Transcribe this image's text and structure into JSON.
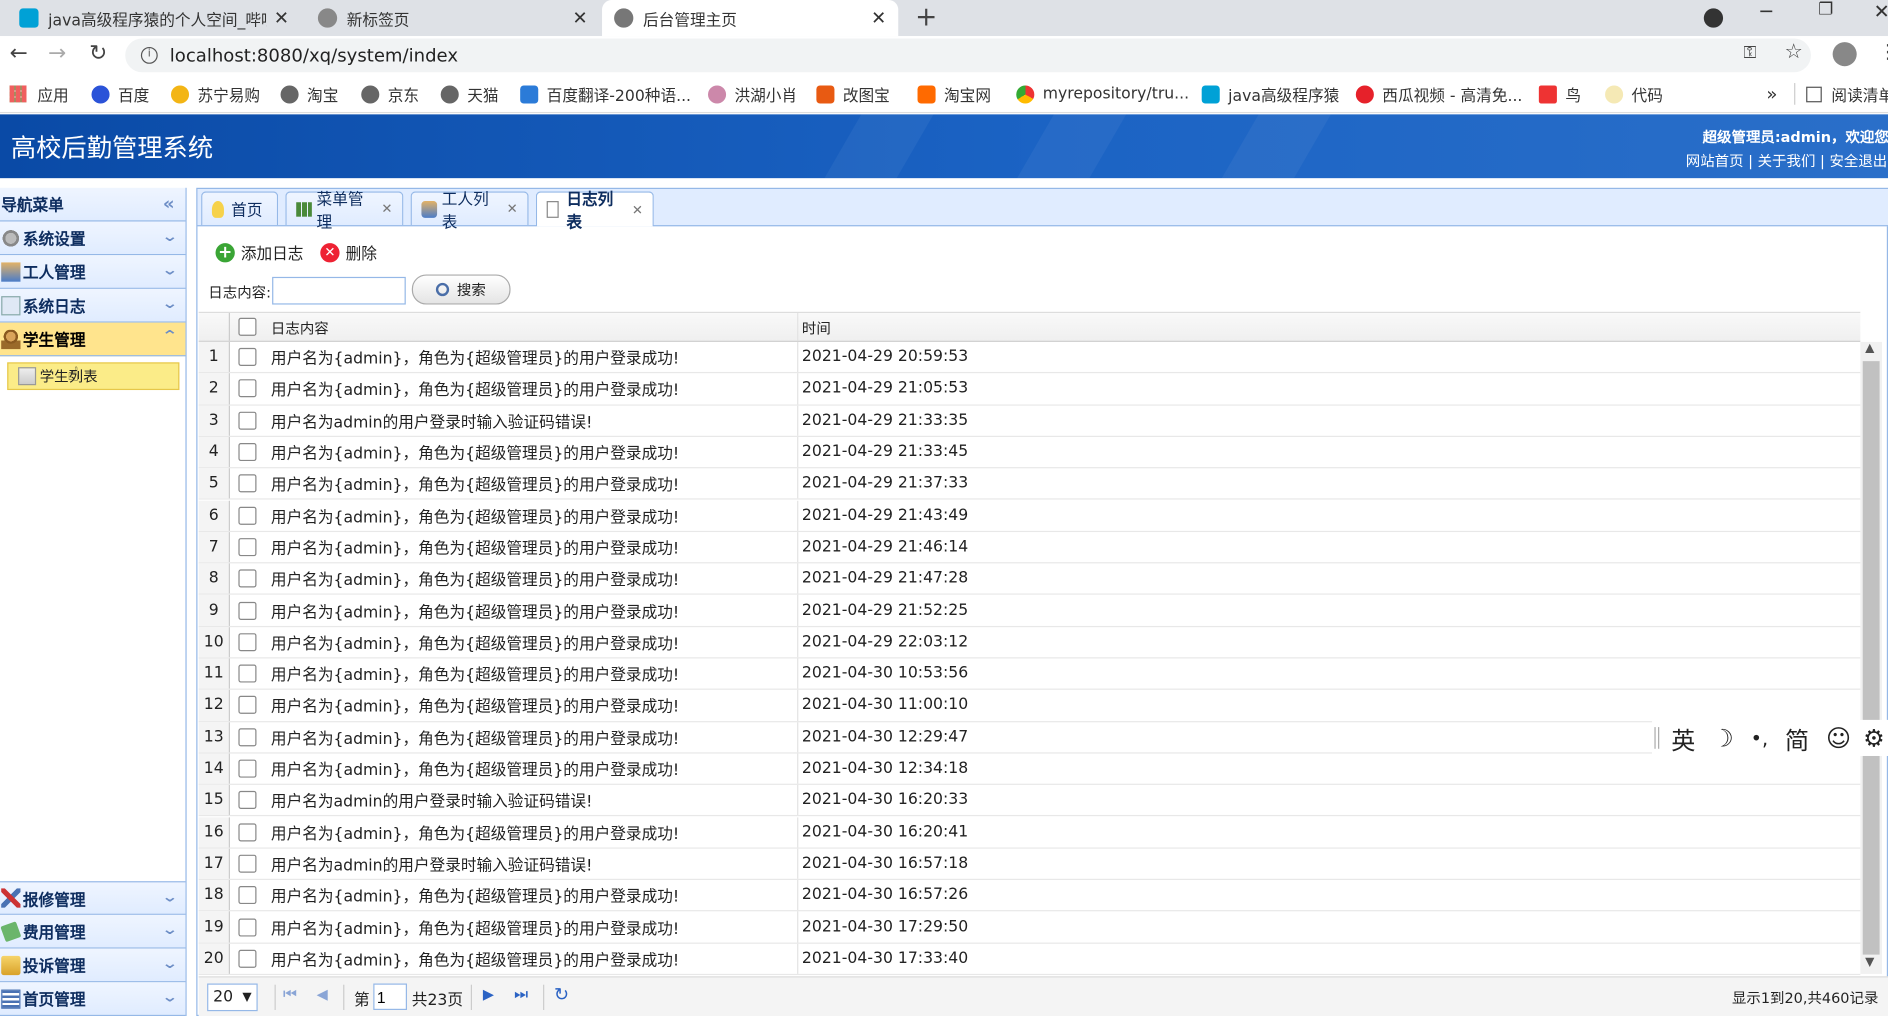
{
  "browser": {
    "tabs": [
      {
        "title": "java高级程序猿的个人空间_哔哩",
        "close": "✕"
      },
      {
        "title": "新标签页",
        "close": "✕"
      },
      {
        "title": "后台管理主页",
        "close": "✕"
      }
    ],
    "new_tab": "+",
    "url": "localhost:8080/xq/system/index",
    "bookmarks": [
      "应用",
      "百度",
      "苏宁易购",
      "淘宝",
      "京东",
      "天猫",
      "百度翻译-200种语...",
      "洪湖小肖",
      "改图宝",
      "淘宝网",
      "myrepository/tru...",
      "java高级程序猿",
      "西瓜视频 - 高清免...",
      "鸟",
      "代码"
    ],
    "bookmarks_more": "»",
    "reading_list": "阅读清单"
  },
  "app": {
    "title": "高校后勤管理系统",
    "welcome": "超级管理员:admin，欢迎您",
    "links": "网站首页 | 关于我们 | 安全退出"
  },
  "nav": {
    "title": "导航菜单",
    "groups": [
      {
        "label": "系统设置"
      },
      {
        "label": "工人管理"
      },
      {
        "label": "系统日志"
      },
      {
        "label": "学生管理"
      }
    ],
    "sub_item": "学生列表",
    "bottom_groups": [
      {
        "label": "报修管理"
      },
      {
        "label": "费用管理"
      },
      {
        "label": "投诉管理"
      },
      {
        "label": "首页管理"
      }
    ]
  },
  "main_tabs": [
    {
      "label": "首页"
    },
    {
      "label": "菜单管理"
    },
    {
      "label": "工人列表"
    },
    {
      "label": "日志列表"
    }
  ],
  "toolbar": {
    "add": "添加日志",
    "delete": "删除"
  },
  "search": {
    "label": "日志内容:",
    "value": "",
    "button": "搜索"
  },
  "table": {
    "columns": [
      "日志内容",
      "时间"
    ],
    "rows": [
      [
        "1",
        "用户名为{admin}，角色为{超级管理员}的用户登录成功!",
        "2021-04-29 20:59:53"
      ],
      [
        "2",
        "用户名为{admin}，角色为{超级管理员}的用户登录成功!",
        "2021-04-29 21:05:53"
      ],
      [
        "3",
        "用户名为admin的用户登录时输入验证码错误!",
        "2021-04-29 21:33:35"
      ],
      [
        "4",
        "用户名为{admin}，角色为{超级管理员}的用户登录成功!",
        "2021-04-29 21:33:45"
      ],
      [
        "5",
        "用户名为{admin}，角色为{超级管理员}的用户登录成功!",
        "2021-04-29 21:37:33"
      ],
      [
        "6",
        "用户名为{admin}，角色为{超级管理员}的用户登录成功!",
        "2021-04-29 21:43:49"
      ],
      [
        "7",
        "用户名为{admin}，角色为{超级管理员}的用户登录成功!",
        "2021-04-29 21:46:14"
      ],
      [
        "8",
        "用户名为{admin}，角色为{超级管理员}的用户登录成功!",
        "2021-04-29 21:47:28"
      ],
      [
        "9",
        "用户名为{admin}，角色为{超级管理员}的用户登录成功!",
        "2021-04-29 21:52:25"
      ],
      [
        "10",
        "用户名为{admin}，角色为{超级管理员}的用户登录成功!",
        "2021-04-29 22:03:12"
      ],
      [
        "11",
        "用户名为{admin}，角色为{超级管理员}的用户登录成功!",
        "2021-04-30 10:53:56"
      ],
      [
        "12",
        "用户名为{admin}，角色为{超级管理员}的用户登录成功!",
        "2021-04-30 11:00:10"
      ],
      [
        "13",
        "用户名为{admin}，角色为{超级管理员}的用户登录成功!",
        "2021-04-30 12:29:47"
      ],
      [
        "14",
        "用户名为{admin}，角色为{超级管理员}的用户登录成功!",
        "2021-04-30 12:34:18"
      ],
      [
        "15",
        "用户名为admin的用户登录时输入验证码错误!",
        "2021-04-30 16:20:33"
      ],
      [
        "16",
        "用户名为{admin}，角色为{超级管理员}的用户登录成功!",
        "2021-04-30 16:20:41"
      ],
      [
        "17",
        "用户名为admin的用户登录时输入验证码错误!",
        "2021-04-30 16:57:18"
      ],
      [
        "18",
        "用户名为{admin}，角色为{超级管理员}的用户登录成功!",
        "2021-04-30 16:57:26"
      ],
      [
        "19",
        "用户名为{admin}，角色为{超级管理员}的用户登录成功!",
        "2021-04-30 17:29:50"
      ],
      [
        "20",
        "用户名为{admin}，角色为{超级管理员}的用户登录成功!",
        "2021-04-30 17:33:40"
      ]
    ]
  },
  "pager": {
    "page_size": "20",
    "page_prefix": "第",
    "page_value": "1",
    "total_pages": "共23页",
    "summary": "显示1到20,共460记录"
  },
  "ime": {
    "lang": "英",
    "moon": "☽",
    "punct": "•,",
    "simp": "简",
    "emoji": "☺",
    "gear": "⚙"
  }
}
